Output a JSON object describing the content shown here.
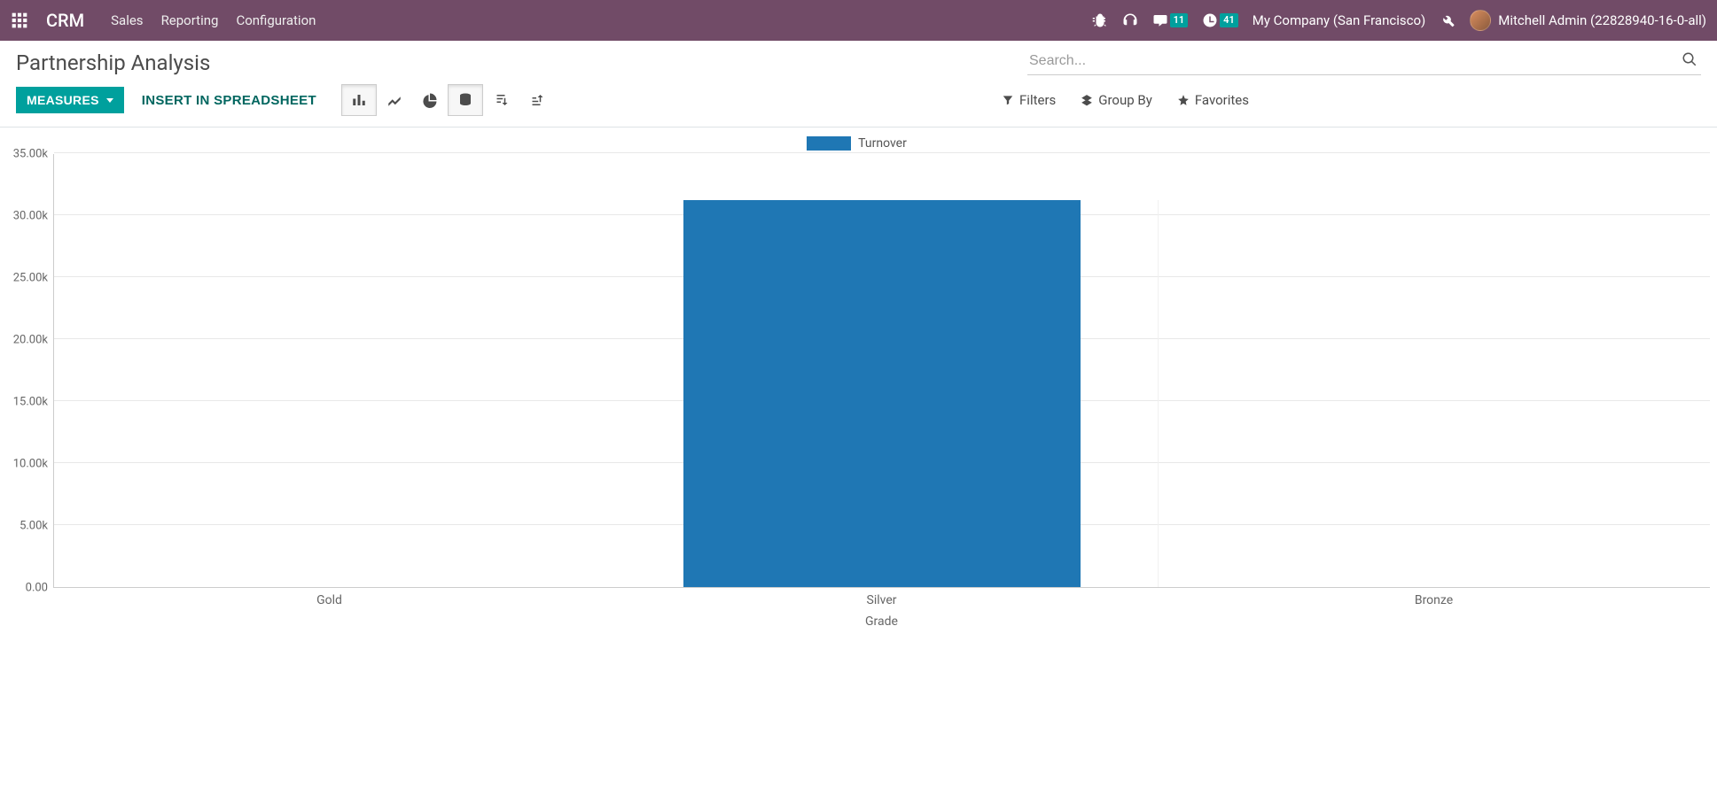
{
  "navbar": {
    "brand": "CRM",
    "links": [
      "Sales",
      "Reporting",
      "Configuration"
    ],
    "messages_badge": "11",
    "activities_badge": "41",
    "company": "My Company (San Francisco)",
    "user": "Mitchell Admin (22828940-16-0-all)"
  },
  "page": {
    "title": "Partnership Analysis"
  },
  "search": {
    "placeholder": "Search..."
  },
  "toolbar": {
    "measures_label": "MEASURES",
    "insert_label": "INSERT IN SPREADSHEET",
    "filters_label": "Filters",
    "groupby_label": "Group By",
    "favorites_label": "Favorites"
  },
  "legend": {
    "series_label": "Turnover"
  },
  "chart_data": {
    "type": "bar",
    "title": "",
    "xlabel": "Grade",
    "ylabel": "",
    "categories": [
      "Gold",
      "Silver",
      "Bronze"
    ],
    "values": [
      0,
      31200,
      0
    ],
    "ylim": [
      0,
      35000
    ],
    "y_ticks": [
      0,
      5000,
      10000,
      15000,
      20000,
      25000,
      30000,
      35000
    ],
    "y_tick_labels": [
      "0.00",
      "5.00k",
      "10.00k",
      "15.00k",
      "20.00k",
      "25.00k",
      "30.00k",
      "35.00k"
    ],
    "series_color": "#1f77b4"
  }
}
